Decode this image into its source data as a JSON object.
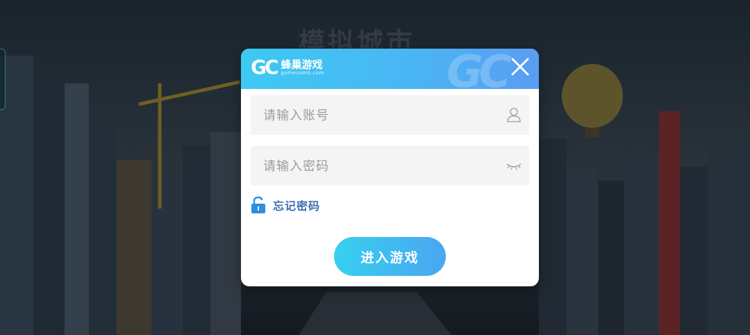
{
  "background": {
    "game_title": "模拟城市"
  },
  "dialog": {
    "logo": {
      "mark": "GC",
      "name": "蜂巢游戏",
      "domain": "gamecomb.com",
      "watermark": "GC"
    },
    "account_field": {
      "placeholder": "请输入账号",
      "value": "",
      "icon": "user-icon"
    },
    "password_field": {
      "placeholder": "请输入密码",
      "value": "",
      "icon": "eye-closed-icon"
    },
    "forgot_password": {
      "label": "忘记密码",
      "icon": "lock-open-icon"
    },
    "enter_button": {
      "label": "进入游戏"
    }
  },
  "colors": {
    "header_gradient_start": "#3dc9f2",
    "header_gradient_end": "#5a9cf2",
    "button_gradient_start": "#36d0f0",
    "button_gradient_end": "#4aa6f0",
    "link": "#3d6fb5",
    "field_bg": "#f3f4f3"
  }
}
